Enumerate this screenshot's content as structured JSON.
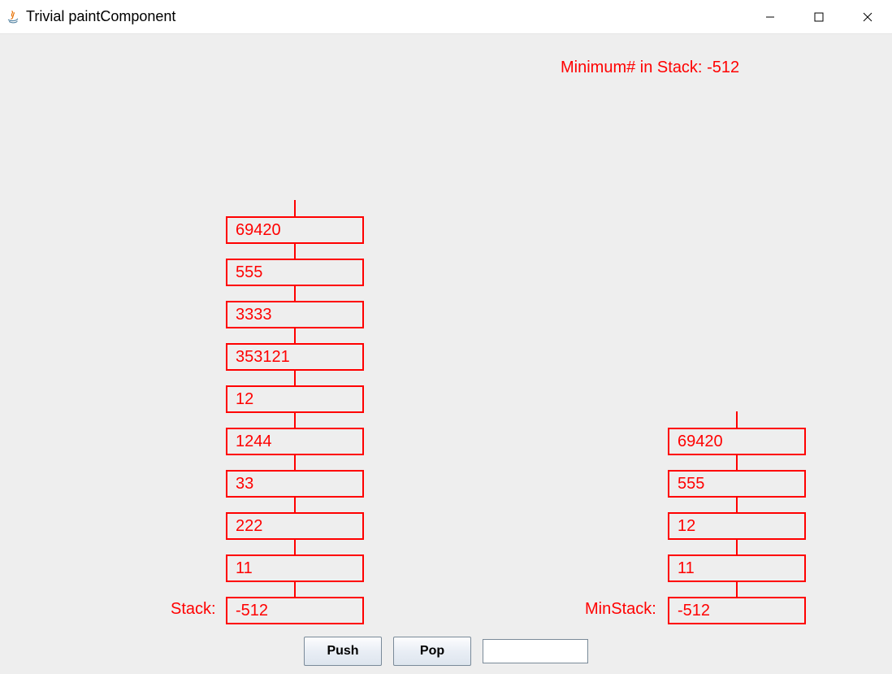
{
  "window": {
    "title": "Trivial paintComponent"
  },
  "status": {
    "label_prefix": "Minimum# in Stack: ",
    "min_value": "-512"
  },
  "stack": {
    "label": "Stack:",
    "items": [
      "69420",
      "555",
      "3333",
      "353121",
      "12",
      "1244",
      "33",
      "222",
      "11",
      "-512"
    ]
  },
  "minstack": {
    "label": "MinStack:",
    "items": [
      "69420",
      "555",
      "12",
      "11",
      "-512"
    ]
  },
  "controls": {
    "push_label": "Push",
    "pop_label": "Pop",
    "input_value": ""
  }
}
